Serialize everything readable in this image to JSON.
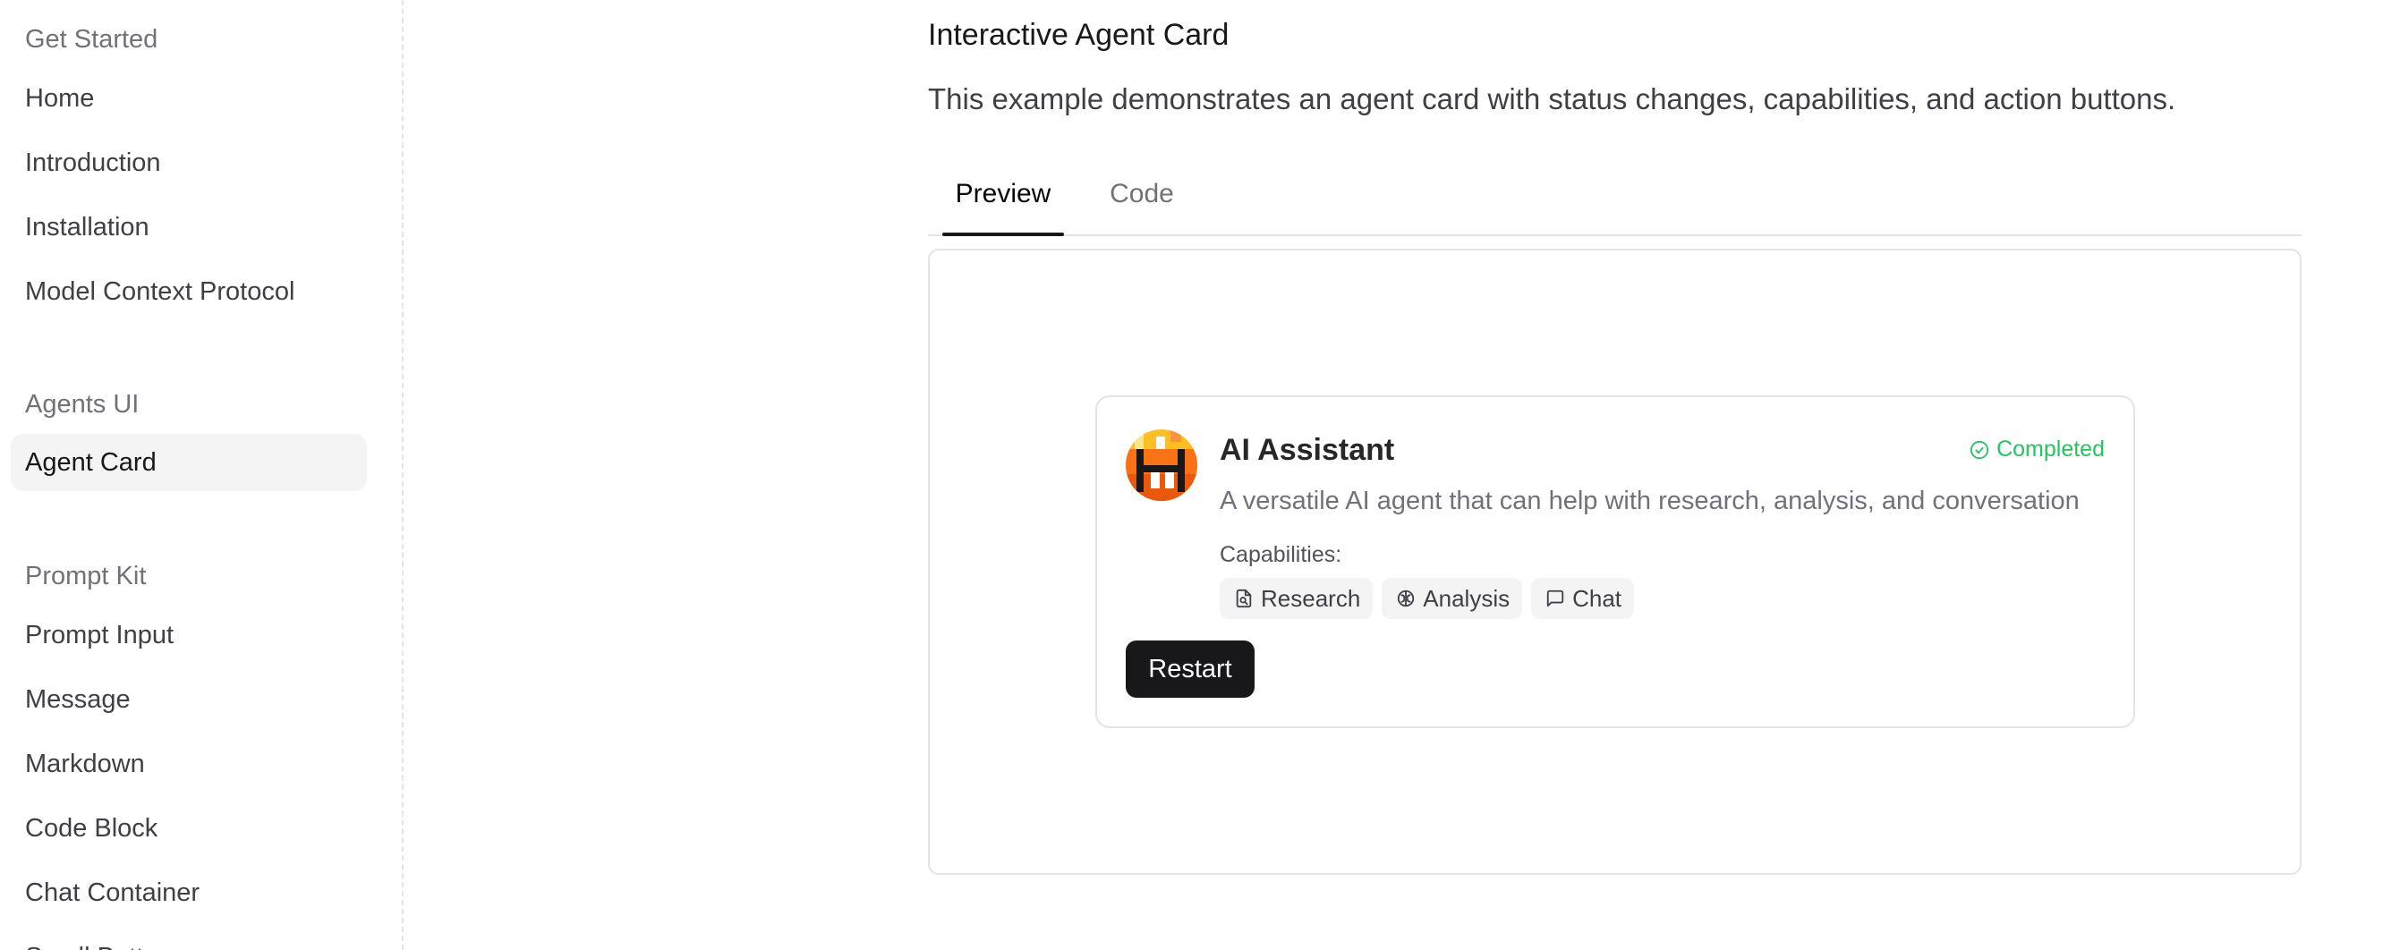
{
  "sidebar": {
    "groups": [
      {
        "title": "Get Started",
        "items": [
          "Home",
          "Introduction",
          "Installation",
          "Model Context Protocol"
        ]
      },
      {
        "title": "Agents UI",
        "items": [
          "Agent Card"
        ]
      },
      {
        "title": "Prompt Kit",
        "items": [
          "Prompt Input",
          "Message",
          "Markdown",
          "Code Block",
          "Chat Container",
          "Scroll Button"
        ]
      }
    ],
    "active_item": "Agent Card"
  },
  "main": {
    "heading": "Interactive Agent Card",
    "description": "This example demonstrates an agent card with status changes, capabilities, and action buttons.",
    "tabs": [
      {
        "label": "Preview"
      },
      {
        "label": "Code"
      }
    ],
    "active_tab": "Preview"
  },
  "agent_card": {
    "name": "AI Assistant",
    "status": "Completed",
    "description": "A versatile AI agent that can help with research, analysis, and conversation",
    "capabilities_label": "Capabilities:",
    "capabilities": [
      {
        "label": "Research",
        "icon": "file-search-icon"
      },
      {
        "label": "Analysis",
        "icon": "brain-icon"
      },
      {
        "label": "Chat",
        "icon": "message-square-icon"
      }
    ],
    "action_label": "Restart"
  },
  "colors": {
    "status_green": "#22c55e",
    "button_bg": "#18181b",
    "active_nav_bg": "#f4f4f5",
    "avatar_orange": "#f97316",
    "avatar_yellow": "#fbbf24"
  }
}
